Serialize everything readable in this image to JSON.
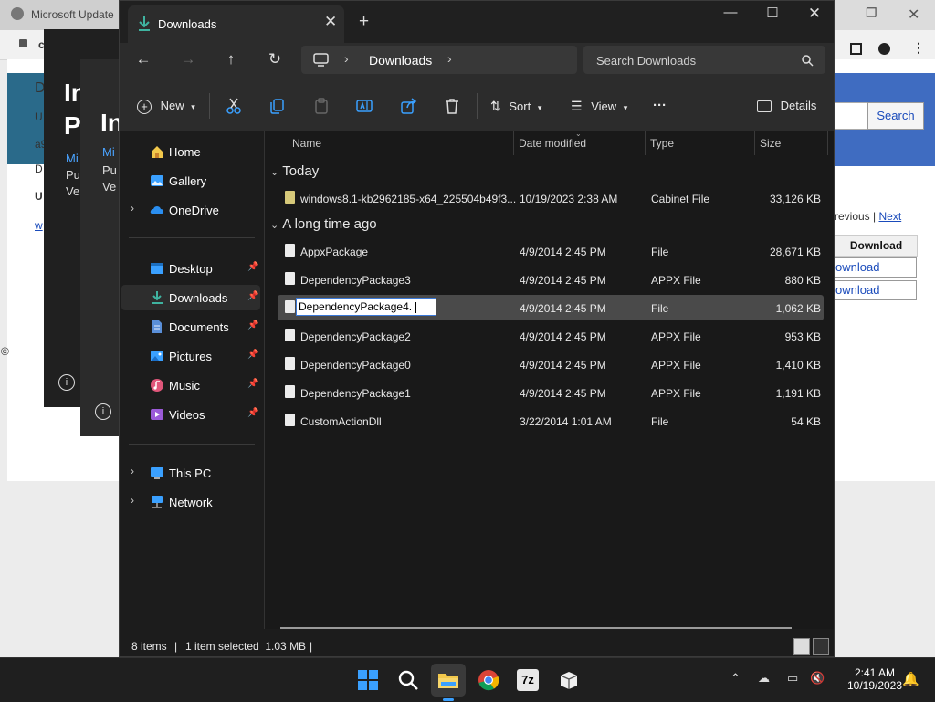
{
  "browser": {
    "tab_title": "Microsoft Update",
    "url": "c",
    "search_button": "Search",
    "pager_prev": "revious",
    "pager_sep": "|",
    "pager_next": "Next",
    "download_header": "Download",
    "download_links": [
      "ownload",
      "ownload"
    ],
    "side_text": [
      "D",
      "U",
      "a9",
      "D",
      "U",
      "w",
      "©"
    ]
  },
  "dialogs": {
    "d1": {
      "title_1": "In",
      "title_2": "Pa",
      "line_1": "Mi",
      "line_2": "Pu",
      "line_3": "Ve"
    },
    "d2": {
      "title_1": "In",
      "line_1": "Mi",
      "line_2": "Pu",
      "line_3": "Ve"
    },
    "info_glyph": "i"
  },
  "explorer": {
    "tab_title": "Downloads",
    "breadcrumb": "Downloads",
    "search_placeholder": "Search Downloads",
    "toolbar": {
      "new_label": "New",
      "sort_label": "Sort",
      "view_label": "View",
      "more_label": "···",
      "details_label": "Details"
    },
    "nav": {
      "home": "Home",
      "gallery": "Gallery",
      "onedrive": "OneDrive",
      "desktop": "Desktop",
      "downloads": "Downloads",
      "documents": "Documents",
      "pictures": "Pictures",
      "music": "Music",
      "videos": "Videos",
      "thispc": "This PC",
      "network": "Network"
    },
    "columns": {
      "name": "Name",
      "date": "Date modified",
      "type": "Type",
      "size": "Size"
    },
    "groups": {
      "today": "Today",
      "older": "A long time ago"
    },
    "files_today": [
      {
        "name": "windows8.1-kb2962185-x64_225504b49f3...",
        "date": "10/19/2023 2:38 AM",
        "type": "Cabinet File",
        "size": "33,126 KB"
      }
    ],
    "files_older": [
      {
        "name": "AppxPackage",
        "date": "4/9/2014 2:45 PM",
        "type": "File",
        "size": "28,671 KB"
      },
      {
        "name": "DependencyPackage3",
        "date": "4/9/2014 2:45 PM",
        "type": "APPX File",
        "size": "880 KB"
      },
      {
        "name": "DependencyPackage4.",
        "date": "4/9/2014 2:45 PM",
        "type": "File",
        "size": "1,062 KB"
      },
      {
        "name": "DependencyPackage2",
        "date": "4/9/2014 2:45 PM",
        "type": "APPX File",
        "size": "953 KB"
      },
      {
        "name": "DependencyPackage0",
        "date": "4/9/2014 2:45 PM",
        "type": "APPX File",
        "size": "1,410 KB"
      },
      {
        "name": "DependencyPackage1",
        "date": "4/9/2014 2:45 PM",
        "type": "APPX File",
        "size": "1,191 KB"
      },
      {
        "name": "CustomActionDll",
        "date": "3/22/2014 1:01 AM",
        "type": "File",
        "size": "54 KB"
      }
    ],
    "status": {
      "count": "8 items",
      "sep": "|",
      "selected": "1 item selected  1.03 MB",
      "sep2": "|"
    }
  },
  "taskbar": {
    "time": "2:41 AM",
    "date": "10/19/2023",
    "sevenzip_label": "7z"
  },
  "colors": {
    "explorer_bg": "#191919",
    "accent": "#0078d4",
    "folder_yellow": "#f2c84b"
  }
}
